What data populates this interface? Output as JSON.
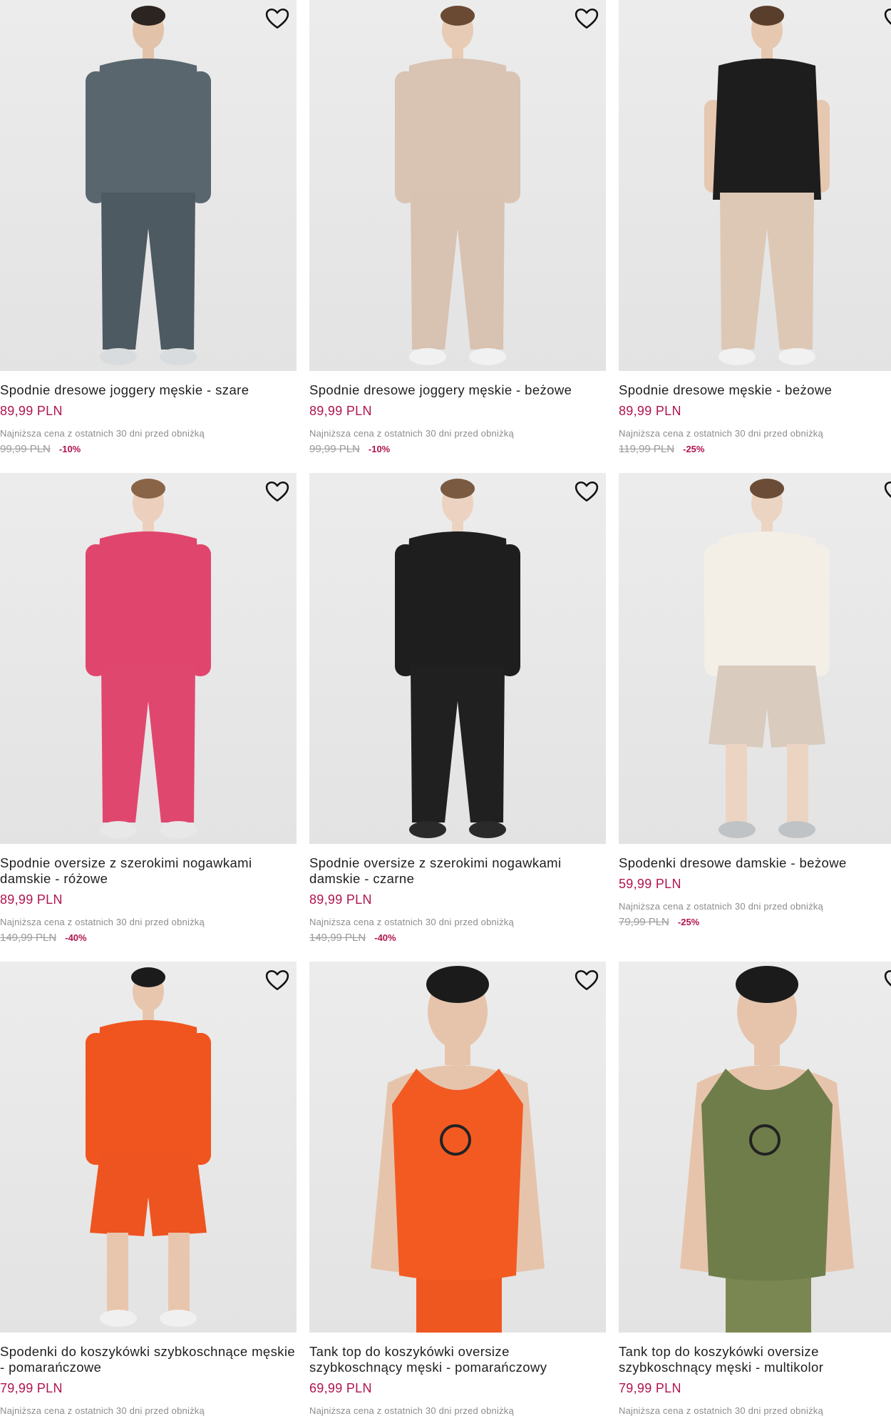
{
  "products": [
    {
      "name": "Spodnie dresowe joggery męskie - szare",
      "price": "89,99 PLN",
      "lowest_note": "Najniższa cena z ostatnich 30 dni przed obniżką",
      "old_price": "99,99 PLN",
      "discount": "-10%",
      "colors": {
        "top": "#59666e",
        "bottom": "#4e5a62",
        "skin": "#e2c3aa",
        "hair": "#2b2420",
        "shoes": "#d9dcde"
      }
    },
    {
      "name": "Spodnie dresowe joggery męskie - beżowe",
      "price": "89,99 PLN",
      "lowest_note": "Najniższa cena z ostatnich 30 dni przed obniżką",
      "old_price": "99,99 PLN",
      "discount": "-10%",
      "colors": {
        "top": "#d9c3b3",
        "bottom": "#d8c2b2",
        "skin": "#e8cbb4",
        "hair": "#6b4a33",
        "shoes": "#f1f1f1"
      }
    },
    {
      "name": "Spodnie dresowe męskie - beżowe",
      "price": "89,99 PLN",
      "lowest_note": "Najniższa cena z ostatnich 30 dni przed obniżką",
      "old_price": "119,99 PLN",
      "discount": "-25%",
      "colors": {
        "top": "#1d1d1d",
        "bottom": "#ddc8b6",
        "skin": "#e6c7b0",
        "hair": "#5a3e2c",
        "shoes": "#f1f1f1"
      }
    },
    {
      "name": "Spodnie oversize z szerokimi nogawkami damskie - różowe",
      "price": "89,99 PLN",
      "lowest_note": "Najniższa cena z ostatnich 30 dni przed obniżką",
      "old_price": "149,99 PLN",
      "discount": "-40%",
      "colors": {
        "top": "#e0466d",
        "bottom": "#e0476e",
        "skin": "#ecd0bd",
        "hair": "#8a6446",
        "shoes": "#e8e8e8"
      }
    },
    {
      "name": "Spodnie oversize z szerokimi nogawkami damskie - czarne",
      "price": "89,99 PLN",
      "lowest_note": "Najniższa cena z ostatnich 30 dni przed obniżką",
      "old_price": "149,99 PLN",
      "discount": "-40%",
      "colors": {
        "top": "#1e1e1e",
        "bottom": "#202020",
        "skin": "#ecd2c0",
        "hair": "#7a5a40",
        "shoes": "#2a2a2a"
      }
    },
    {
      "name": "Spodenki dresowe damskie - beżowe",
      "price": "59,99 PLN",
      "lowest_note": "Najniższa cena z ostatnich 30 dni przed obniżką",
      "old_price": "79,99 PLN",
      "discount": "-25%",
      "colors": {
        "top": "#f3efe6",
        "bottom": "#d9cbbd",
        "skin": "#ecd4c3",
        "hair": "#6b4d37",
        "shoes": "#bfc3c5"
      }
    },
    {
      "name": "Spodenki do koszykówki szybkoschnące męskie - pomarańczowe",
      "price": "79,99 PLN",
      "lowest_note": "Najniższa cena z ostatnich 30 dni przed obniżką",
      "old_price": "",
      "discount": "",
      "colors": {
        "top": "#f0551f",
        "bottom": "#ee5420",
        "skin": "#e8c6ae",
        "hair": "#1b1b1b",
        "shoes": "#f0f0f0"
      }
    },
    {
      "name": "Tank top do koszykówki oversize szybkoschnący męski - pomarańczowy",
      "price": "69,99 PLN",
      "lowest_note": "Najniższa cena z ostatnich 30 dni przed obniżką",
      "old_price": "",
      "discount": "",
      "colors": {
        "top": "#f25a22",
        "bottom": "#ef5720",
        "skin": "#e6c4ab",
        "hair": "#1b1b1b",
        "shoes": "#f0f0f0"
      }
    },
    {
      "name": "Tank top do koszykówki oversize szybkoschnący męski - multikolor",
      "price": "79,99 PLN",
      "lowest_note": "Najniższa cena z ostatnich 30 dni przed obniżką",
      "old_price": "",
      "discount": "",
      "colors": {
        "top": "#6f7d4a",
        "bottom": "#7b8752",
        "skin": "#e6c4ab",
        "hair": "#1b1b1b",
        "shoes": "#f0f0f0"
      }
    }
  ]
}
